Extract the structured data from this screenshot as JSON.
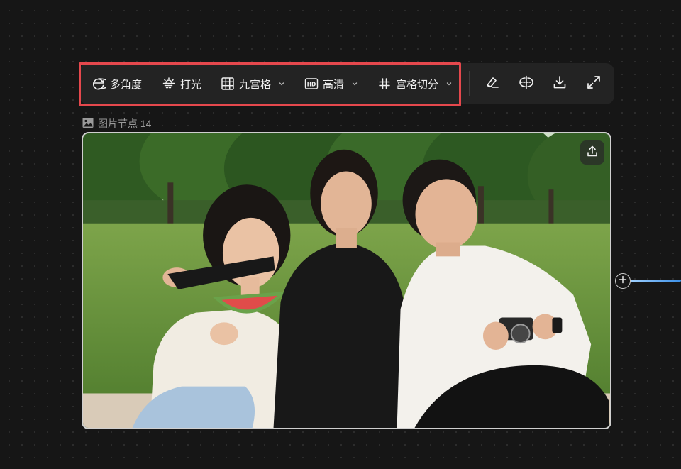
{
  "toolbar": {
    "multi_angle": {
      "label": "多角度",
      "icon": "multi-angle-icon"
    },
    "lighting": {
      "label": "打光",
      "icon": "lighting-icon"
    },
    "nine_grid": {
      "label": "九宫格",
      "icon": "grid-icon"
    },
    "hd": {
      "label": "高清",
      "icon": "hd-icon"
    },
    "grid_split": {
      "label": "宫格切分",
      "icon": "hash-icon"
    },
    "actions": [
      "eraser-icon",
      "crop-icon",
      "download-icon",
      "fullscreen-icon"
    ]
  },
  "node": {
    "label": "图片节点 14",
    "icon": "image-icon"
  },
  "colors": {
    "canvas": "#161616",
    "toolbar": "#232323",
    "highlight": "#e5484d",
    "connector": "#3b8fe6"
  }
}
